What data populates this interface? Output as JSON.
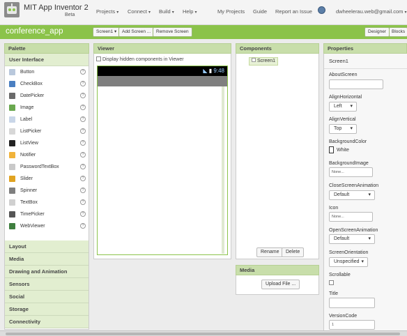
{
  "header": {
    "app_title": "MIT App Inventor 2",
    "app_subtitle": "Beta",
    "menus": [
      "Projects",
      "Connect",
      "Build",
      "Help"
    ],
    "links": [
      "My Projects",
      "Guide",
      "Report an Issue"
    ],
    "account": "dwheelerau.web@gmail.com"
  },
  "toolbar": {
    "project_name": "conference_app",
    "screen_dropdown": "Screen1 ▾",
    "add_screen": "Add Screen ...",
    "remove_screen": "Remove Screen",
    "designer": "Designer",
    "blocks": "Blocks"
  },
  "palette": {
    "title": "Palette",
    "active_category": "User Interface",
    "items": [
      {
        "label": "Button",
        "icon": "button-icon",
        "color": "#b9c8dc"
      },
      {
        "label": "CheckBox",
        "icon": "checkbox-icon",
        "color": "#4a7fc1"
      },
      {
        "label": "DatePicker",
        "icon": "datepicker-icon",
        "color": "#6a6a6a"
      },
      {
        "label": "Image",
        "icon": "image-icon",
        "color": "#6aa84f"
      },
      {
        "label": "Label",
        "icon": "label-icon",
        "color": "#c9d6e8"
      },
      {
        "label": "ListPicker",
        "icon": "listpicker-icon",
        "color": "#d7d7d7"
      },
      {
        "label": "ListView",
        "icon": "listview-icon",
        "color": "#222222"
      },
      {
        "label": "Notifier",
        "icon": "notifier-icon",
        "color": "#f1b33a"
      },
      {
        "label": "PasswordTextBox",
        "icon": "password-icon",
        "color": "#c9c9c9"
      },
      {
        "label": "Slider",
        "icon": "slider-icon",
        "color": "#e0a321"
      },
      {
        "label": "Spinner",
        "icon": "spinner-icon",
        "color": "#7f7f7f"
      },
      {
        "label": "TextBox",
        "icon": "textbox-icon",
        "color": "#d0d0d0"
      },
      {
        "label": "TimePicker",
        "icon": "timepicker-icon",
        "color": "#555555"
      },
      {
        "label": "WebViewer",
        "icon": "webviewer-icon",
        "color": "#3f7f3f"
      }
    ],
    "help_glyph": "?",
    "categories": [
      "Layout",
      "Media",
      "Drawing and Animation",
      "Sensors",
      "Social",
      "Storage",
      "Connectivity"
    ]
  },
  "viewer": {
    "title": "Viewer",
    "checkbox_label": "Display hidden components in Viewer",
    "status_time": "9:48"
  },
  "components": {
    "title": "Components",
    "tree_item": "Screen1",
    "rename": "Rename",
    "delete": "Delete"
  },
  "media": {
    "title": "Media",
    "upload": "Upload File ..."
  },
  "properties": {
    "title": "Properties",
    "component": "Screen1",
    "about_label": "AboutScreen",
    "align_h_label": "AlignHorizontal",
    "align_h_value": "Left",
    "align_v_label": "AlignVertical",
    "align_v_value": "Top",
    "bg_color_label": "BackgroundColor",
    "bg_color_value": "White",
    "bg_image_label": "BackgroundImage",
    "bg_image_value": "None...",
    "close_anim_label": "CloseScreenAnimation",
    "close_anim_value": "Default",
    "icon_label": "Icon",
    "icon_value": "None...",
    "open_anim_label": "OpenScreenAnimation",
    "open_anim_value": "Default",
    "orientation_label": "ScreenOrientation",
    "orientation_value": "Unspecified",
    "scrollable_label": "Scrollable",
    "title_label": "Title",
    "version_code_label": "VersionCode",
    "version_code_value": "1"
  },
  "colors": {
    "accent_green": "#8bc34a",
    "panel_header": "#c8deaa"
  }
}
